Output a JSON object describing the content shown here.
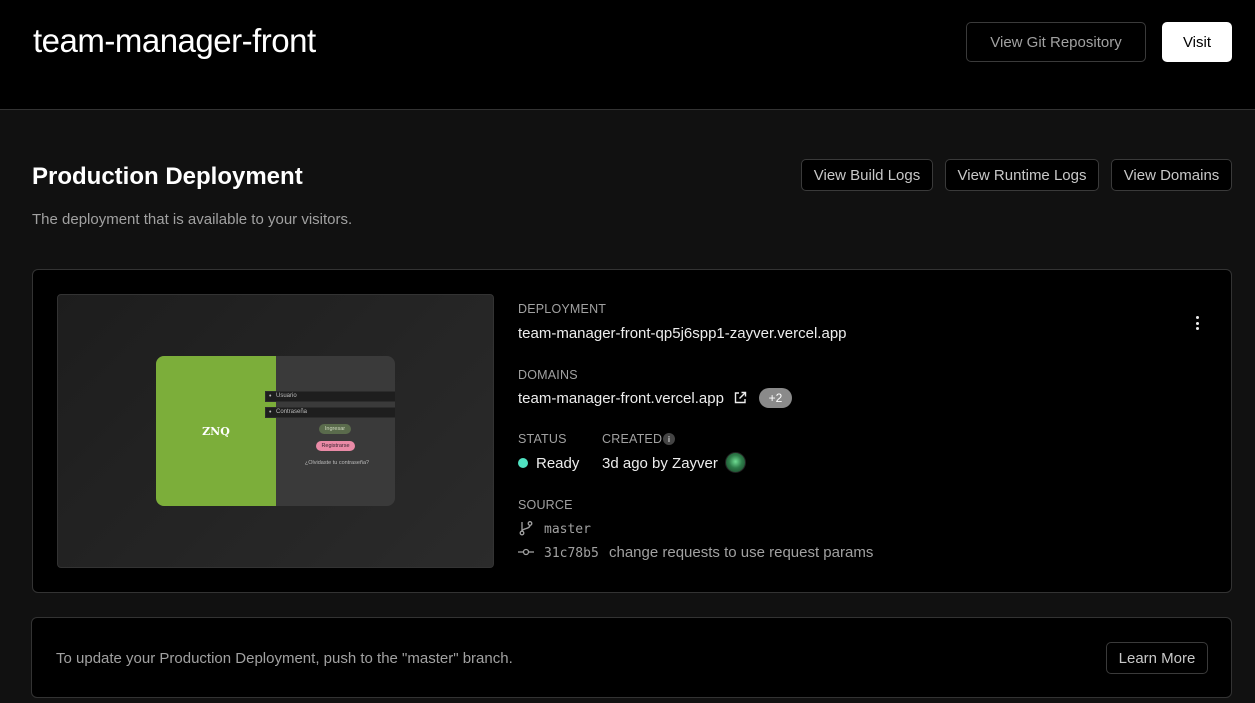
{
  "header": {
    "project_name": "team-manager-front",
    "git_button": "View Git Repository",
    "visit_button": "Visit"
  },
  "section": {
    "title": "Production Deployment",
    "subtitle": "The deployment that is available to your visitors.",
    "build_logs_button": "View Build Logs",
    "runtime_logs_button": "View Runtime Logs",
    "domains_button": "View Domains"
  },
  "preview": {
    "logo": "ZNQ",
    "username_placeholder": "Usuario",
    "password_placeholder": "Contraseña",
    "login_button": "Ingresar",
    "register_button": "Registrarse",
    "forgot_link": "¿Olvidaste tu contraseña?"
  },
  "deployment": {
    "deployment_label": "DEPLOYMENT",
    "deployment_url": "team-manager-front-qp5j6spp1-zayver.vercel.app",
    "domains_label": "DOMAINS",
    "domain": "team-manager-front.vercel.app",
    "extra_domains_badge": "+2",
    "status_label": "STATUS",
    "status_value": "Ready",
    "status_color": "#50e3c2",
    "created_label": "CREATED",
    "created_value": "3d ago by Zayver",
    "source_label": "SOURCE",
    "branch": "master",
    "commit_hash": "31c78b5",
    "commit_message": "change requests to use request params"
  },
  "footer_note": {
    "text": "To update your Production Deployment, push to the \"master\" branch.",
    "learn_more_button": "Learn More"
  }
}
